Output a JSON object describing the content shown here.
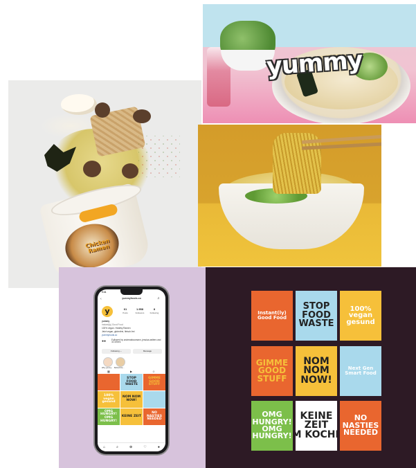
{
  "brand": {
    "wordmark": "yummy"
  },
  "cup_label": {
    "line1": "Chicken",
    "line2": "Ramen"
  },
  "profile": {
    "status_time": "9:41",
    "handle": "yummyfoods.co",
    "display_name": "yummy",
    "bio": [
      "Instant(ly) Good Food",
      "100% vegan. Healthy Ramen",
      "Jetzt vegan, glutenfrei, fleisch-frei",
      "yummyfoods.co"
    ],
    "followed_by": "Followed by andreasbaumann, jessica.walters and 32 others",
    "stats": [
      {
        "value": "61",
        "label": "Posts"
      },
      {
        "value": "1.958",
        "label": "Followers"
      },
      {
        "value": "8",
        "label": "Following"
      }
    ],
    "buttons": {
      "following": "Following ⌄",
      "message": "Message"
    },
    "highlights": [
      "Why yummy",
      "Behind the..."
    ],
    "grid": [
      {
        "text": "",
        "bg": "#e9662f",
        "fg": "#fff"
      },
      {
        "text": "STOP FOOD WASTE",
        "bg": "#a9d9ec",
        "fg": "#222"
      },
      {
        "text": "GIMME GOOD STUFF",
        "bg": "#e9662f",
        "fg": "#f6c03a"
      },
      {
        "text": "100% vegan gesund",
        "bg": "#f6c03a",
        "fg": "#fff"
      },
      {
        "text": "NOM NOM NOW!",
        "bg": "#f6c03a",
        "fg": "#222"
      },
      {
        "text": "",
        "bg": "#a9d9ec",
        "fg": "#222"
      },
      {
        "text": "OMG HUNGRY! OMG HUNGRY!",
        "bg": "#7cbf4a",
        "fg": "#fff"
      },
      {
        "text": "KEINE ZEIT",
        "bg": "#f6c03a",
        "fg": "#222"
      },
      {
        "text": "NO NASTIES NEEDED",
        "bg": "#e9662f",
        "fg": "#fff"
      }
    ],
    "nav": [
      "⌂",
      "⌕",
      "⊕",
      "♡",
      "●"
    ]
  },
  "posters": [
    {
      "lines": [
        "Instant(ly)",
        "Good Food"
      ],
      "bg": "#e9662f",
      "fg": "#fff",
      "size": 7
    },
    {
      "lines": [
        "STOP",
        "FOOD",
        "WASTE"
      ],
      "bg": "#a9d9ec",
      "fg": "#222",
      "size": 13
    },
    {
      "lines": [
        "100%",
        "vegan",
        "gesund"
      ],
      "bg": "#f6c03a",
      "fg": "#fff",
      "size": 10
    },
    {
      "lines": [
        "GIMME",
        "GOOD",
        "STUFF"
      ],
      "bg": "#e9662f",
      "fg": "#f6c03a",
      "size": 12
    },
    {
      "lines": [
        "NOM",
        "NOM",
        "NOW!"
      ],
      "bg": "#f6c03a",
      "fg": "#222",
      "size": 14
    },
    {
      "lines": [
        "Next Gen",
        "Smart Food"
      ],
      "bg": "#a9d9ec",
      "fg": "#fff",
      "size": 7
    },
    {
      "lines": [
        "OMG",
        "HUNGRY!",
        "OMG",
        "HUNGRY!"
      ],
      "bg": "#7cbf4a",
      "fg": "#fff",
      "size": 11
    },
    {
      "lines": [
        "KEINE",
        "ZEIT",
        "ZUM KOCHEN?"
      ],
      "bg": "#ffffff",
      "fg": "#222",
      "size": 14
    },
    {
      "lines": [
        "NO",
        "NASTIES",
        "NEEDED"
      ],
      "bg": "#e9662f",
      "fg": "#fff",
      "size": 11
    }
  ],
  "colors": {
    "orange": "#e9662f",
    "yellow": "#f6c03a",
    "blue": "#a9d9ec",
    "green": "#7cbf4a",
    "plum": "#2d1a25",
    "lilac": "#d7c3dc"
  }
}
